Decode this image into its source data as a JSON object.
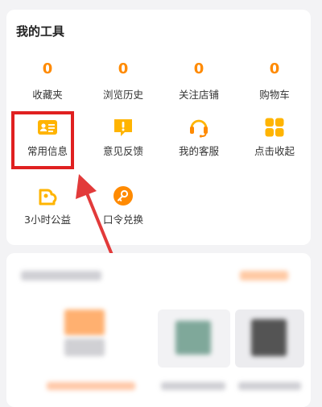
{
  "section_title": "我的工具",
  "stats": [
    {
      "value": "0",
      "label": "收藏夹"
    },
    {
      "value": "0",
      "label": "浏览历史"
    },
    {
      "value": "0",
      "label": "关注店铺"
    },
    {
      "value": "0",
      "label": "购物车"
    }
  ],
  "tools": [
    {
      "label": "常用信息",
      "icon": "id-card-icon"
    },
    {
      "label": "意见反馈",
      "icon": "feedback-icon"
    },
    {
      "label": "我的客服",
      "icon": "headset-icon"
    },
    {
      "label": "点击收起",
      "icon": "grid-icon"
    },
    {
      "label": "3小时公益",
      "icon": "charity-heart-icon"
    },
    {
      "label": "口令兑换",
      "icon": "redeem-key-icon"
    }
  ],
  "colors": {
    "accent": "#ff8a00",
    "highlight": "#e02020"
  }
}
